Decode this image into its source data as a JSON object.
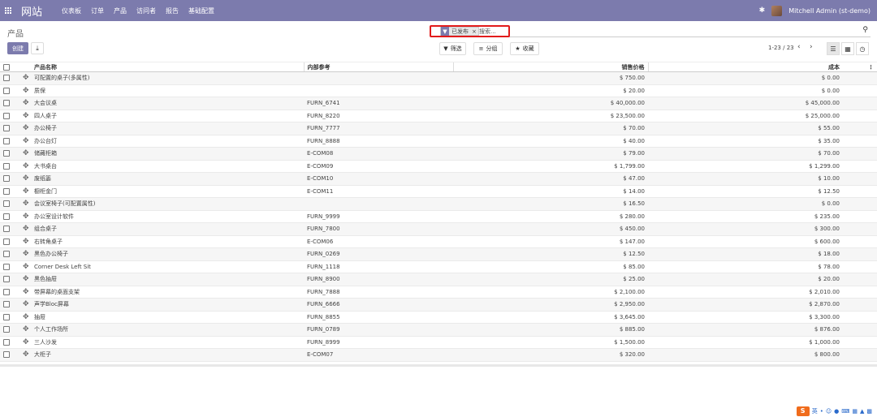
{
  "navbar": {
    "brand": "网站",
    "menu": [
      "仪表板",
      "订单",
      "产品",
      "访问者",
      "报告",
      "基础配置"
    ],
    "user": "Mitchell Admin (st-demo)"
  },
  "control": {
    "breadcrumb": "产品",
    "create": "创建",
    "search": {
      "facet": "已发布",
      "placeholder": "搜索..."
    },
    "filters": "筛选",
    "group": "分组",
    "favorites": "收藏",
    "pager": "1-23 / 23"
  },
  "table": {
    "headers": {
      "name": "产品名称",
      "ref": "内部参考",
      "price": "销售价格",
      "cost": "成本"
    },
    "rows": [
      {
        "name": "可配置的桌子(多属性)",
        "ref": "",
        "price": "$ 750.00",
        "cost": "$ 0.00"
      },
      {
        "name": "质保",
        "ref": "",
        "price": "$ 20.00",
        "cost": "$ 0.00"
      },
      {
        "name": "大会议桌",
        "ref": "FURN_6741",
        "price": "$ 40,000.00",
        "cost": "$ 45,000.00"
      },
      {
        "name": "四人桌子",
        "ref": "FURN_8220",
        "price": "$ 23,500.00",
        "cost": "$ 25,000.00"
      },
      {
        "name": "办公椅子",
        "ref": "FURN_7777",
        "price": "$ 70.00",
        "cost": "$ 55.00"
      },
      {
        "name": "办公台灯",
        "ref": "FURN_8888",
        "price": "$ 40.00",
        "cost": "$ 35.00"
      },
      {
        "name": "储藏柜箱",
        "ref": "E-COM08",
        "price": "$ 79.00",
        "cost": "$ 70.00"
      },
      {
        "name": "大书桌台",
        "ref": "E-COM09",
        "price": "$ 1,799.00",
        "cost": "$ 1,299.00"
      },
      {
        "name": "废纸篓",
        "ref": "E-COM10",
        "price": "$ 47.00",
        "cost": "$ 10.00"
      },
      {
        "name": "橱柜金门",
        "ref": "E-COM11",
        "price": "$ 14.00",
        "cost": "$ 12.50"
      },
      {
        "name": "会议室椅子(可配置属性)",
        "ref": "",
        "price": "$ 16.50",
        "cost": "$ 0.00"
      },
      {
        "name": "办公室设计软件",
        "ref": "FURN_9999",
        "price": "$ 280.00",
        "cost": "$ 235.00"
      },
      {
        "name": "组合桌子",
        "ref": "FURN_7800",
        "price": "$ 450.00",
        "cost": "$ 300.00"
      },
      {
        "name": "右转角桌子",
        "ref": "E-COM06",
        "price": "$ 147.00",
        "cost": "$ 600.00"
      },
      {
        "name": "黑色办公椅子",
        "ref": "FURN_0269",
        "price": "$ 12.50",
        "cost": "$ 18.00"
      },
      {
        "name": "Corner Desk Left Sit",
        "ref": "FURN_1118",
        "price": "$ 85.00",
        "cost": "$ 78.00"
      },
      {
        "name": "黑色抽屉",
        "ref": "FURN_8900",
        "price": "$ 25.00",
        "cost": "$ 20.00"
      },
      {
        "name": "带屏幕的桌面支架",
        "ref": "FURN_7888",
        "price": "$ 2,100.00",
        "cost": "$ 2,010.00"
      },
      {
        "name": "声学Bloc屏幕",
        "ref": "FURN_6666",
        "price": "$ 2,950.00",
        "cost": "$ 2,870.00"
      },
      {
        "name": "抽屉",
        "ref": "FURN_8855",
        "price": "$ 3,645.00",
        "cost": "$ 3,300.00"
      },
      {
        "name": "个人工作场所",
        "ref": "FURN_0789",
        "price": "$ 885.00",
        "cost": "$ 876.00"
      },
      {
        "name": "三人沙发",
        "ref": "FURN_8999",
        "price": "$ 1,500.00",
        "cost": "$ 1,000.00"
      },
      {
        "name": "大柜子",
        "ref": "E-COM07",
        "price": "$ 320.00",
        "cost": "$ 800.00"
      }
    ]
  },
  "tray": {
    "lang": "英"
  },
  "colors": {
    "navbar": "#7c7bad",
    "highlight": "#e21b1b"
  }
}
